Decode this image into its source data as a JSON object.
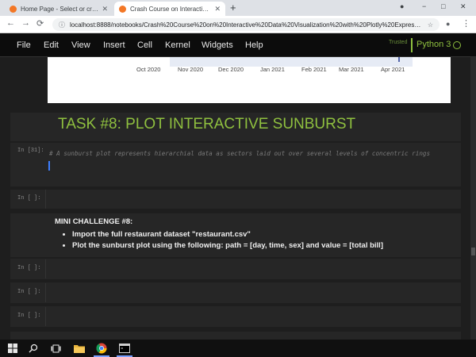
{
  "browser": {
    "tabs": [
      {
        "title": "Home Page - Select or create a n",
        "favicon_color": "#f37726",
        "active": false
      },
      {
        "title": "Crash Course on Interactive Data",
        "favicon_color": "#f37726",
        "active": true
      }
    ],
    "new_tab_label": "+",
    "window_controls": [
      "−",
      "□",
      "✕"
    ],
    "url": "localhost:8888/notebooks/Crash%20Course%20on%20Interactive%20Data%20Visualization%20with%20Plotly%20Express...",
    "nav": {
      "back": "←",
      "forward": "→",
      "reload": "⟳",
      "lock": "ⓘ",
      "star": "☆"
    }
  },
  "jupyter": {
    "menu": [
      "File",
      "Edit",
      "View",
      "Insert",
      "Cell",
      "Kernel",
      "Widgets",
      "Help"
    ],
    "trusted_label": "Trusted",
    "kernel_name": "Python 3"
  },
  "chart_output": {
    "x_ticks": [
      "Oct 2020",
      "Nov 2020",
      "Dec 2020",
      "Jan 2021",
      "Feb 2021",
      "Mar 2021",
      "Apr 2021"
    ]
  },
  "cells": {
    "task_title": "TASK #8: PLOT INTERACTIVE SUNBURST",
    "code_prompt": "In [31]:",
    "code_comment": "# A sunburst plot represents hierarchial data as sectors laid out over several levels of concentric rings",
    "empty_prompt": "In [ ]:",
    "challenge_title": "MINI CHALLENGE #8:",
    "challenge_items": [
      "Import the full restaurant dataset \"restaurant.csv\"",
      "Plot the sunburst plot using the following: path = [day, time, sex] and value = [total bill]"
    ]
  },
  "taskbar": {
    "icons": [
      "windows-start",
      "search",
      "task-view",
      "file-explorer",
      "chrome",
      "terminal"
    ]
  }
}
